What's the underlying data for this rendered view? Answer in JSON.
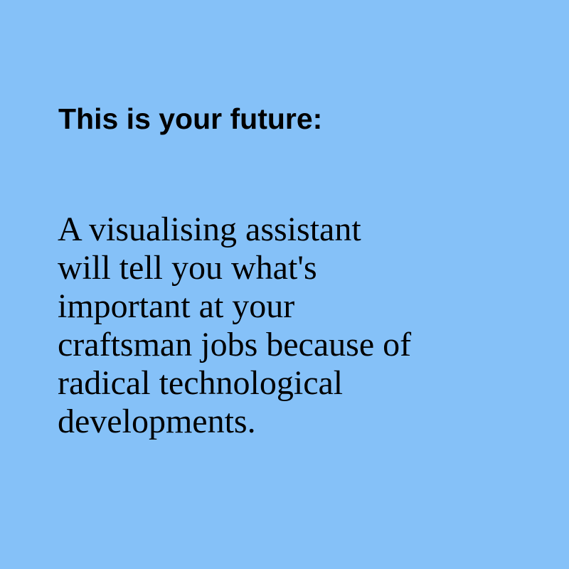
{
  "colors": {
    "background": "#85c1f8",
    "text": "#000000"
  },
  "heading": "This is your future:",
  "body": {
    "lines": [
      "A visualising assistant",
      "will tell you what's",
      "important at your",
      "craftsman jobs because of",
      "radical technological",
      "developments."
    ]
  }
}
